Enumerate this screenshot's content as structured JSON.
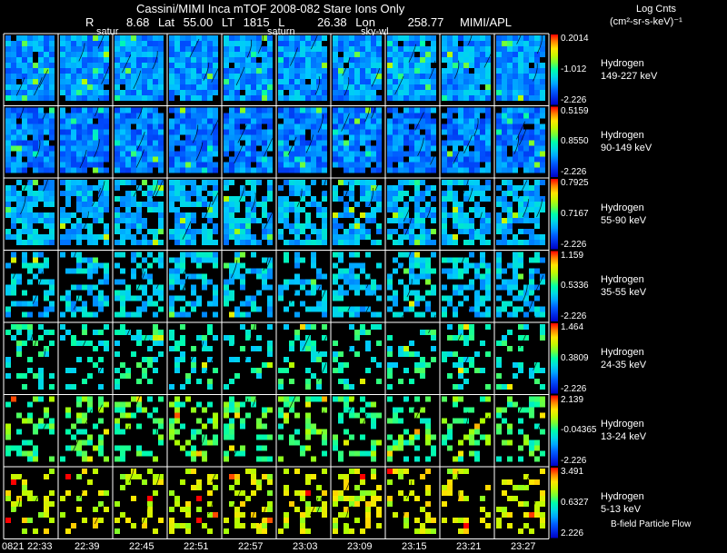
{
  "header": {
    "title": "Cassini/MIMI Inca mTOF  2008-082   Stare    Ions Only",
    "r_label": "R",
    "r_value": "8.68",
    "lat_label": "Lat",
    "lat_value": "55.00",
    "lt_label": "LT",
    "lt_value": "1815",
    "l_label": "L",
    "l_value": "26.38",
    "lon_label": "Lon",
    "lon_value": "258.77",
    "org": "MIMI/APL"
  },
  "mini_labels": {
    "first": "satur",
    "second": "saturn",
    "third": "sky-wl"
  },
  "units": {
    "title": "Log Cnts",
    "sub": "(cm²-sr-s-keV)⁻¹"
  },
  "bands": [
    {
      "name": "Hydrogen",
      "energy": "149-227 keV",
      "max": "0.2014",
      "mid": "-1.012",
      "min": "-2.226",
      "base_level": 0.28,
      "density": 0.97
    },
    {
      "name": "Hydrogen",
      "energy": "90-149 keV",
      "max": "0.5159",
      "mid": "0.8550",
      "min": "-2.226",
      "base_level": 0.24,
      "density": 0.95
    },
    {
      "name": "Hydrogen",
      "energy": "55-90 keV",
      "max": "0.7925",
      "mid": "0.7167",
      "min": "-2.226",
      "base_level": 0.33,
      "density": 0.72
    },
    {
      "name": "Hydrogen",
      "energy": "35-55 keV",
      "max": "1.159",
      "mid": "0.5336",
      "min": "-2.226",
      "base_level": 0.36,
      "density": 0.48
    },
    {
      "name": "Hydrogen",
      "energy": "24-35 keV",
      "max": "1.464",
      "mid": "0.3809",
      "min": "-2.226",
      "base_level": 0.46,
      "density": 0.32
    },
    {
      "name": "Hydrogen",
      "energy": "13-24 keV",
      "max": "2.139",
      "mid": "-0.04365",
      "min": "-2.226",
      "base_level": 0.55,
      "density": 0.36
    },
    {
      "name": "Hydrogen",
      "energy": "5-13 keV",
      "max": "3.491",
      "mid": "0.6327",
      "min": "2.226",
      "base_level": 0.72,
      "density": 0.28
    }
  ],
  "times": [
    "0821",
    "22:33",
    "22:39",
    "22:45",
    "22:51",
    "22:57",
    "23:03",
    "23:09",
    "23:15",
    "23:21",
    "23:27"
  ],
  "footer_note": "B-field Particle Flow"
}
